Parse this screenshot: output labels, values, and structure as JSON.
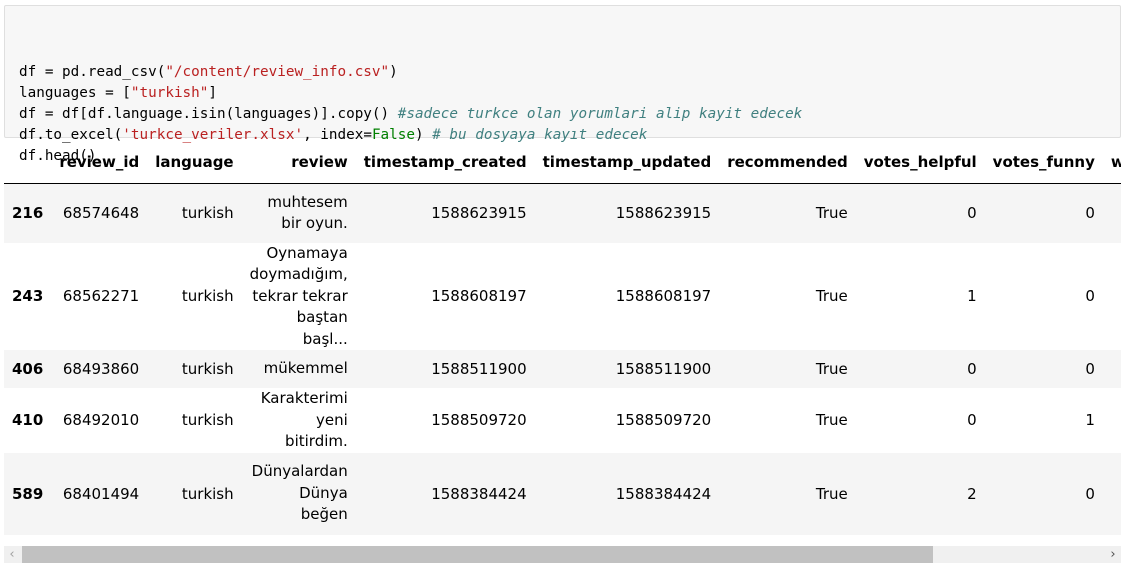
{
  "code_cell": {
    "lines": [
      [
        {
          "t": "df = pd.read_csv(",
          "c": ""
        },
        {
          "t": "\"/content/review_info.csv\"",
          "c": "str"
        },
        {
          "t": ")",
          "c": ""
        }
      ],
      [
        {
          "t": "languages = [",
          "c": ""
        },
        {
          "t": "\"turkish\"",
          "c": "str"
        },
        {
          "t": "]",
          "c": ""
        }
      ],
      [
        {
          "t": "df = df[df.language.isin(languages)].copy() ",
          "c": ""
        },
        {
          "t": "#sadece turkce olan yorumlari alip kayit edecek",
          "c": "cm"
        }
      ],
      [
        {
          "t": "df.to_excel(",
          "c": ""
        },
        {
          "t": "'turkce_veriler.xlsx'",
          "c": "str"
        },
        {
          "t": ", index=",
          "c": ""
        },
        {
          "t": "False",
          "c": "kw"
        },
        {
          "t": ") ",
          "c": ""
        },
        {
          "t": "# bu dosyaya kayıt edecek",
          "c": "cm"
        }
      ],
      [
        {
          "t": "df.head()",
          "c": ""
        }
      ]
    ]
  },
  "table": {
    "columns": [
      "",
      "review_id",
      "language",
      "review",
      "timestamp_created",
      "timestamp_updated",
      "recommended",
      "votes_helpful",
      "votes_funny",
      "weighted_vote_score"
    ],
    "rows": [
      {
        "index": "216",
        "review_id": "68574648",
        "language": "turkish",
        "review_lines": [
          "muhtesem",
          "bir oyun."
        ],
        "timestamp_created": "1588623915",
        "timestamp_updated": "1588623915",
        "recommended": "True",
        "votes_helpful": "0",
        "votes_funny": "0"
      },
      {
        "index": "243",
        "review_id": "68562271",
        "language": "turkish",
        "review_lines": [
          "Oynamaya",
          "doymadığım,",
          "tekrar tekrar",
          "baştan başl..."
        ],
        "timestamp_created": "1588608197",
        "timestamp_updated": "1588608197",
        "recommended": "True",
        "votes_helpful": "1",
        "votes_funny": "0"
      },
      {
        "index": "406",
        "review_id": "68493860",
        "language": "turkish",
        "review_lines": [
          "mükemmel"
        ],
        "timestamp_created": "1588511900",
        "timestamp_updated": "1588511900",
        "recommended": "True",
        "votes_helpful": "0",
        "votes_funny": "0"
      },
      {
        "index": "410",
        "review_id": "68492010",
        "language": "turkish",
        "review_lines": [
          "Karakterimi",
          "yeni bitirdim."
        ],
        "timestamp_created": "1588509720",
        "timestamp_updated": "1588509720",
        "recommended": "True",
        "votes_helpful": "0",
        "votes_funny": "1"
      },
      {
        "index": "589",
        "review_id": "68401494",
        "language": "turkish",
        "review_lines": [
          "Dünyalardan",
          "Dünya",
          "beğen"
        ],
        "timestamp_created": "1588384424",
        "timestamp_updated": "1588384424",
        "recommended": "True",
        "votes_helpful": "2",
        "votes_funny": "0"
      }
    ]
  },
  "scrollbar": {
    "left_arrow": "‹",
    "right_arrow": "›",
    "position_fraction": 0.0,
    "visible_fraction": 0.82
  }
}
